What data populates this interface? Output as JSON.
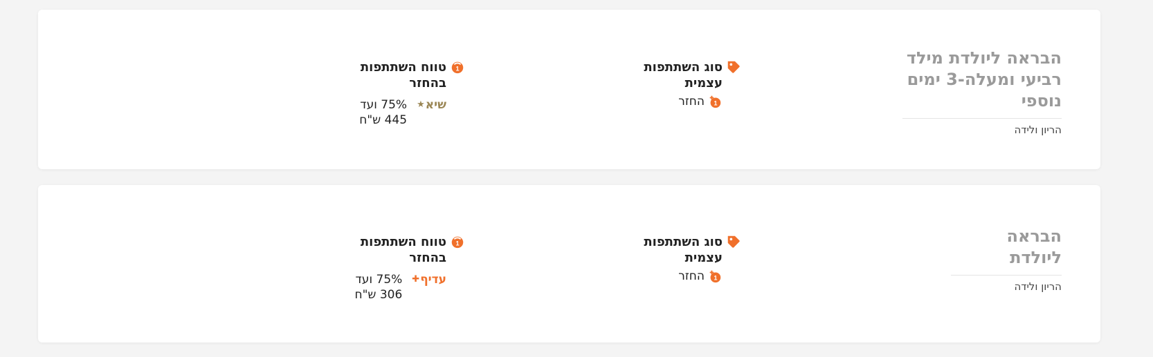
{
  "accent_color": "#f0702b",
  "cards": [
    {
      "title": "הבראה ליולדת מילד רביעי ומעלה-3 ימים נוספי",
      "category": "הריון ולידה",
      "participation_type": {
        "label": "סוג השתתפות עצמית",
        "icon": "tag-icon",
        "value": "החזר",
        "value_icon": "refund-icon"
      },
      "refund_range": {
        "label": "טווח השתתפות בהחזר",
        "icon": "refund-icon",
        "tier_label": "שיא",
        "tier_glyph": "★",
        "range_text": "75% ועד 445 ש\"ח"
      }
    },
    {
      "title": "הבראה ליולדת",
      "category": "הריון ולידה",
      "participation_type": {
        "label": "סוג השתתפות עצמית",
        "icon": "tag-icon",
        "value": "החזר",
        "value_icon": "refund-icon"
      },
      "refund_range": {
        "label": "טווח השתתפות בהחזר",
        "icon": "refund-icon",
        "tier_label": "עדיף",
        "tier_glyph": "✚",
        "range_text": "75% ועד 306 ש\"ח"
      }
    }
  ]
}
